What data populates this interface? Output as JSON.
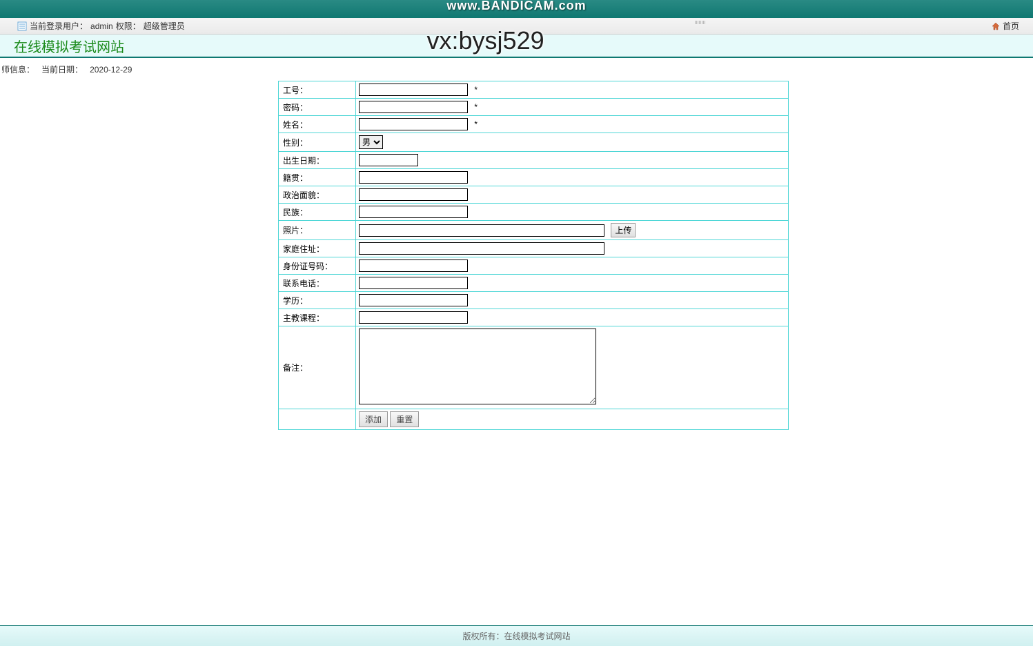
{
  "watermark": {
    "top": "www.BANDICAM.com",
    "center": "vx:bysj529"
  },
  "header": {
    "user_label_prefix": "当前登录用户：",
    "username": "admin",
    "role_label": "权限：",
    "role": "超级管理员",
    "home_label": "首页"
  },
  "site": {
    "title": "在线模拟考试网站"
  },
  "breadcrumb": {
    "section": "师信息：",
    "date_label": "当前日期：",
    "date_value": "2020-12-29"
  },
  "form": {
    "fields": {
      "emp_no": {
        "label": "工号：",
        "required": "*"
      },
      "password": {
        "label": "密码：",
        "required": "*"
      },
      "name": {
        "label": "姓名：",
        "required": "*"
      },
      "gender": {
        "label": "性别：",
        "selected": "男"
      },
      "birthdate": {
        "label": "出生日期："
      },
      "hometown": {
        "label": "籍贯："
      },
      "politics": {
        "label": "政治面貌："
      },
      "ethnicity": {
        "label": "民族："
      },
      "photo": {
        "label": "照片：",
        "upload_btn": "上传"
      },
      "address": {
        "label": "家庭住址："
      },
      "id_card": {
        "label": "身份证号码："
      },
      "phone": {
        "label": "联系电话："
      },
      "education": {
        "label": "学历："
      },
      "course": {
        "label": "主教课程："
      },
      "remark": {
        "label": "备注："
      }
    },
    "buttons": {
      "add": "添加",
      "reset": "重置"
    }
  },
  "footer": {
    "copyright_label": "版权所有：",
    "copyright_text": "在线模拟考试网站"
  }
}
